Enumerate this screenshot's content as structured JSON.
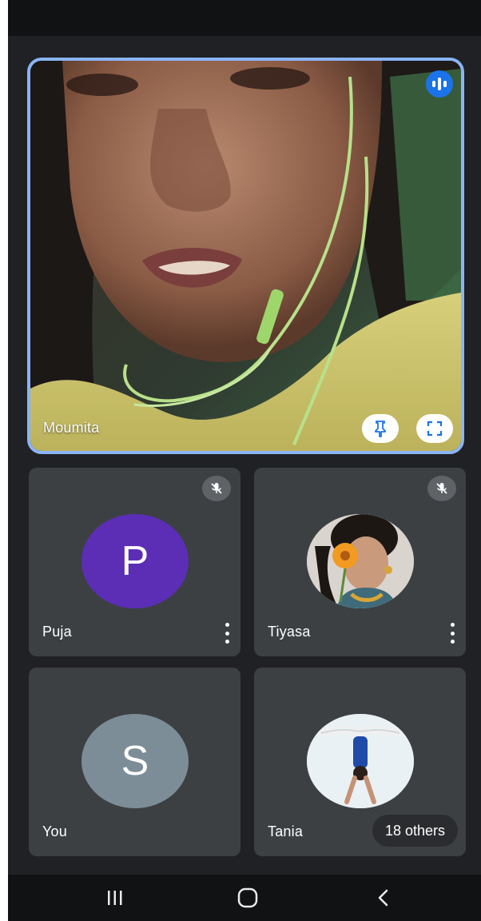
{
  "main_speaker": {
    "name": "Moumita"
  },
  "participants": [
    {
      "name": "Puja",
      "initial": "P",
      "avatar_color": "#5b2eb5"
    },
    {
      "name": "Tiyasa"
    },
    {
      "name": "You",
      "initial": "S",
      "avatar_color": "#7d8d97"
    },
    {
      "name": "Tania",
      "others_label": "18 others"
    }
  ],
  "colors": {
    "background": "#202124",
    "tile": "#3c4043",
    "accent": "#8ab4f8",
    "speaking_badge": "#1a73e8"
  },
  "icons": {
    "speaking": "audio-bars-icon",
    "pin": "pin-icon",
    "fullscreen": "fullscreen-icon",
    "mute": "mic-off-icon",
    "more": "more-vertical-icon",
    "nav_recents": "recents-icon",
    "nav_home": "home-icon",
    "nav_back": "back-icon"
  }
}
